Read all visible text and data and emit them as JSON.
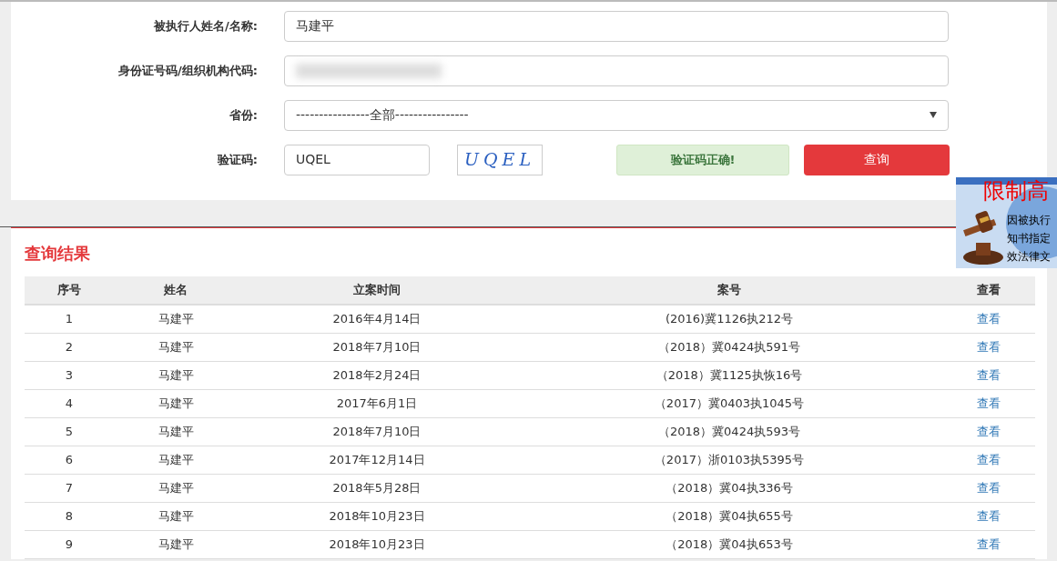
{
  "search_form": {
    "fields": [
      {
        "label": "被执行人姓名/名称:",
        "kind": "text",
        "value": "马建平"
      },
      {
        "label": "身份证号码/组织机构代码:",
        "kind": "redacted"
      },
      {
        "label": "省份:",
        "kind": "select",
        "value": "----------------全部----------------"
      },
      {
        "label": "验证码:",
        "kind": "captcha",
        "value": "UQEL",
        "captcha_text": "UQEL"
      }
    ],
    "captcha_status": "验证码正确!",
    "submit_button": "查询"
  },
  "ad_banner": {
    "title": "限制高",
    "lines": [
      "因被执行",
      "知书指定",
      "效法律文"
    ]
  },
  "results": {
    "title": "查询结果",
    "table": {
      "columns": [
        "序号",
        "姓名",
        "立案时间",
        "案号",
        "查看"
      ],
      "rows": [
        [
          "1",
          "马建平",
          "2016年4月14日",
          "(2016)冀1126执212号",
          "查看"
        ],
        [
          "2",
          "马建平",
          "2018年7月10日",
          "（2018）冀0424执591号",
          "查看"
        ],
        [
          "3",
          "马建平",
          "2018年2月24日",
          "（2018）冀1125执恢16号",
          "查看"
        ],
        [
          "4",
          "马建平",
          "2017年6月1日",
          "（2017）冀0403执1045号",
          "查看"
        ],
        [
          "5",
          "马建平",
          "2018年7月10日",
          "（2018）冀0424执593号",
          "查看"
        ],
        [
          "6",
          "马建平",
          "2017年12月14日",
          "（2017）浙0103执5395号",
          "查看"
        ],
        [
          "7",
          "马建平",
          "2018年5月28日",
          "（2018）冀04执336号",
          "查看"
        ],
        [
          "8",
          "马建平",
          "2018年10月23日",
          "（2018）冀04执655号",
          "查看"
        ],
        [
          "9",
          "马建平",
          "2018年10月23日",
          "（2018）冀04执653号",
          "查看"
        ]
      ]
    }
  }
}
